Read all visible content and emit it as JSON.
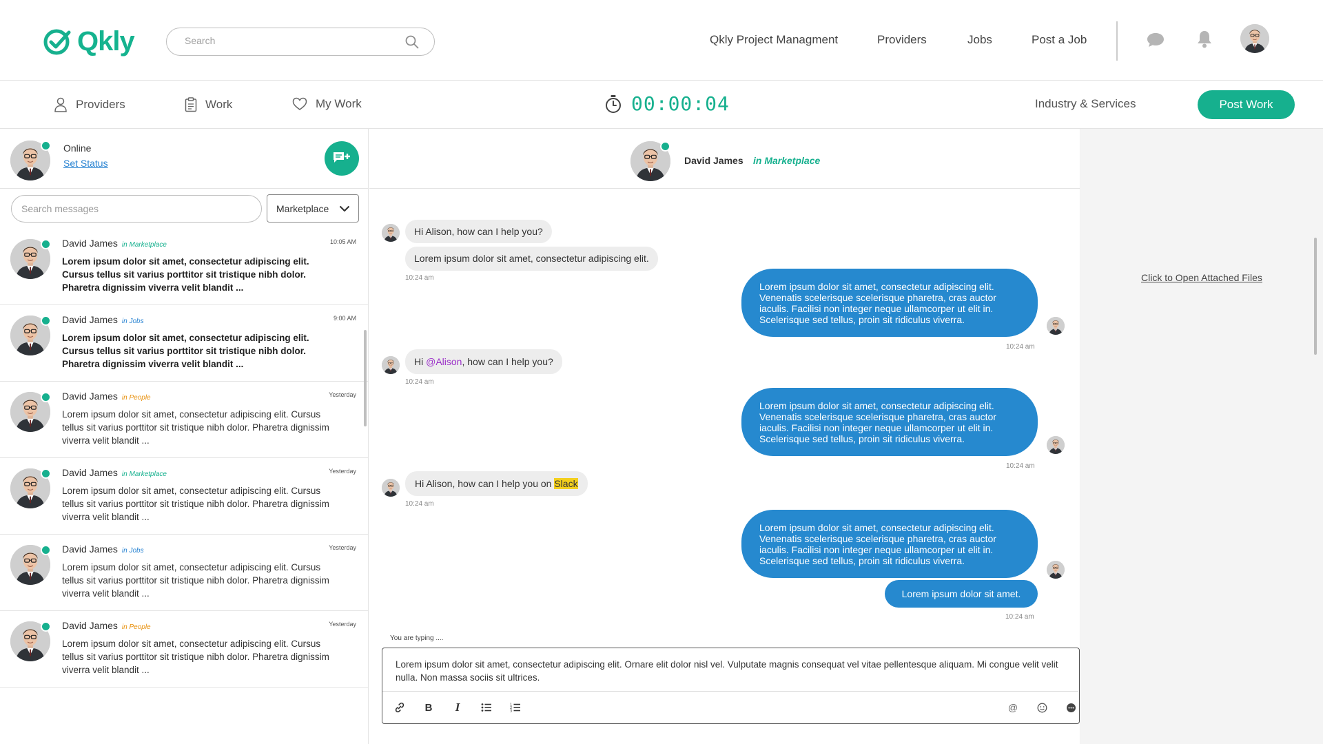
{
  "brand": {
    "name": "Qkly",
    "color": "#16b08e"
  },
  "header": {
    "search_placeholder": "Search",
    "nav": [
      "Qkly Project Managment",
      "Providers",
      "Jobs",
      "Post a Job"
    ]
  },
  "subnav": {
    "items": [
      "Providers",
      "Work",
      "My Work"
    ],
    "timer": "00:00:04",
    "industry": "Industry & Services",
    "post_work": "Post Work"
  },
  "sidebar": {
    "status": "Online",
    "set_status": "Set Status",
    "search_placeholder": "Search messages",
    "filter": "Marketplace",
    "conversations": [
      {
        "name": "David James",
        "tag": "in Marketplace",
        "tag_color": "#16b08e",
        "time": "10:05 AM",
        "unread": true,
        "preview": "Lorem ipsum dolor sit amet, consectetur adipiscing elit. Cursus tellus sit varius porttitor sit tristique nibh dolor. Pharetra dignissim viverra velit blandit ..."
      },
      {
        "name": "David James",
        "tag": "in Jobs",
        "tag_color": "#2a84d2",
        "time": "9:00 AM",
        "unread": true,
        "preview": "Lorem ipsum dolor sit amet, consectetur adipiscing elit. Cursus tellus sit varius porttitor sit tristique nibh dolor. Pharetra dignissim viverra velit blandit ..."
      },
      {
        "name": "David James",
        "tag": "in People",
        "tag_color": "#e8900c",
        "time": "Yesterday",
        "unread": false,
        "preview": "Lorem ipsum dolor sit amet, consectetur adipiscing elit. Cursus tellus sit varius porttitor sit tristique nibh dolor. Pharetra dignissim viverra velit blandit ..."
      },
      {
        "name": "David James",
        "tag": "in Marketplace",
        "tag_color": "#16b08e",
        "time": "Yesterday",
        "unread": false,
        "preview": "Lorem ipsum dolor sit amet, consectetur adipiscing elit. Cursus tellus sit varius porttitor sit tristique nibh dolor. Pharetra dignissim viverra velit blandit ..."
      },
      {
        "name": "David James",
        "tag": "in Jobs",
        "tag_color": "#2a84d2",
        "time": "Yesterday",
        "unread": false,
        "preview": "Lorem ipsum dolor sit amet, consectetur adipiscing elit. Cursus tellus sit varius porttitor sit tristique nibh dolor. Pharetra dignissim viverra velit blandit ..."
      },
      {
        "name": "David James",
        "tag": "in People",
        "tag_color": "#e8900c",
        "time": "Yesterday",
        "unread": false,
        "preview": "Lorem ipsum dolor sit amet, consectetur adipiscing elit. Cursus tellus sit varius porttitor sit tristique nibh dolor. Pharetra dignissim viverra velit blandit ..."
      }
    ]
  },
  "chat": {
    "contact": "David James",
    "context": "in Marketplace",
    "messages": {
      "in1a": "Hi Alison, how can I help you?",
      "in1b": "Lorem ipsum dolor sit amet, consectetur adipiscing elit.",
      "in1_time": "10:24 am",
      "out1": "Lorem ipsum dolor sit amet, consectetur adipiscing elit. Venenatis scelerisque scelerisque pharetra, cras auctor iaculis. Facilisi non integer neque ullamcorper ut elit in. Scelerisque sed tellus, proin sit ridiculus viverra.",
      "out1_time": "10:24 am",
      "in2_pre": "Hi ",
      "in2_mention": "@Alison",
      "in2_post": ", how can I help you?",
      "in2_time": "10:24 am",
      "out2": "Lorem ipsum dolor sit amet, consectetur adipiscing elit. Venenatis scelerisque scelerisque pharetra, cras auctor iaculis. Facilisi non integer neque ullamcorper ut elit in. Scelerisque sed tellus, proin sit ridiculus viverra.",
      "out2_time": "10:24 am",
      "in3_pre": "Hi Alison, how can I help you on ",
      "in3_highlight": "Slack",
      "in3_time": "10:24 am",
      "out3": "Lorem ipsum dolor sit amet, consectetur adipiscing elit. Venenatis scelerisque scelerisque pharetra, cras auctor iaculis. Facilisi non integer neque ullamcorper ut elit in. Scelerisque sed tellus, proin sit ridiculus viverra.",
      "out4": "Lorem ipsum dolor sit amet.",
      "out4_time": "10:24 am"
    },
    "typing": "You are typing ....",
    "draft": "Lorem ipsum dolor sit amet, consectetur adipiscing elit. Ornare elit dolor nisl vel. Vulputate magnis consequat vel vitae pellentesque aliquam. Mi congue velit velit nulla. Non massa sociis sit ultrices.",
    "bubble_color": "#2689cf"
  },
  "right": {
    "files_link": "Click to Open Attached Files"
  }
}
